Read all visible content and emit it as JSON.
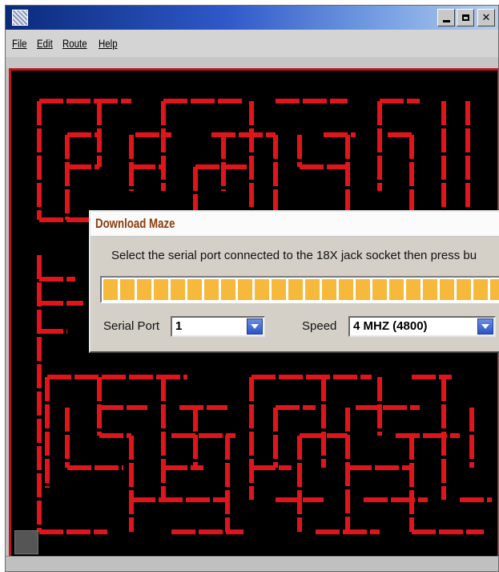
{
  "window": {
    "title": ""
  },
  "menu": {
    "items": [
      "File",
      "Edit",
      "Route",
      "Help"
    ]
  },
  "dialog": {
    "title": "Download Maze",
    "message": "Select the serial port connected to the 18X jack socket then press bu",
    "progress": {
      "fraction_filled": 1.0,
      "color": "#f6b93b"
    },
    "serial_port": {
      "label": "Serial Port",
      "value": "1"
    },
    "speed": {
      "label": "Speed",
      "value": "4 MHZ (4800)"
    }
  },
  "maze": {
    "wall_color": "#e0141b",
    "background_color": "#000000"
  },
  "icons": {
    "app": "maze-app-icon",
    "minimize": "minimize-icon",
    "maximize": "maximize-icon",
    "close": "close-icon",
    "dropdown": "chevron-down-icon"
  }
}
